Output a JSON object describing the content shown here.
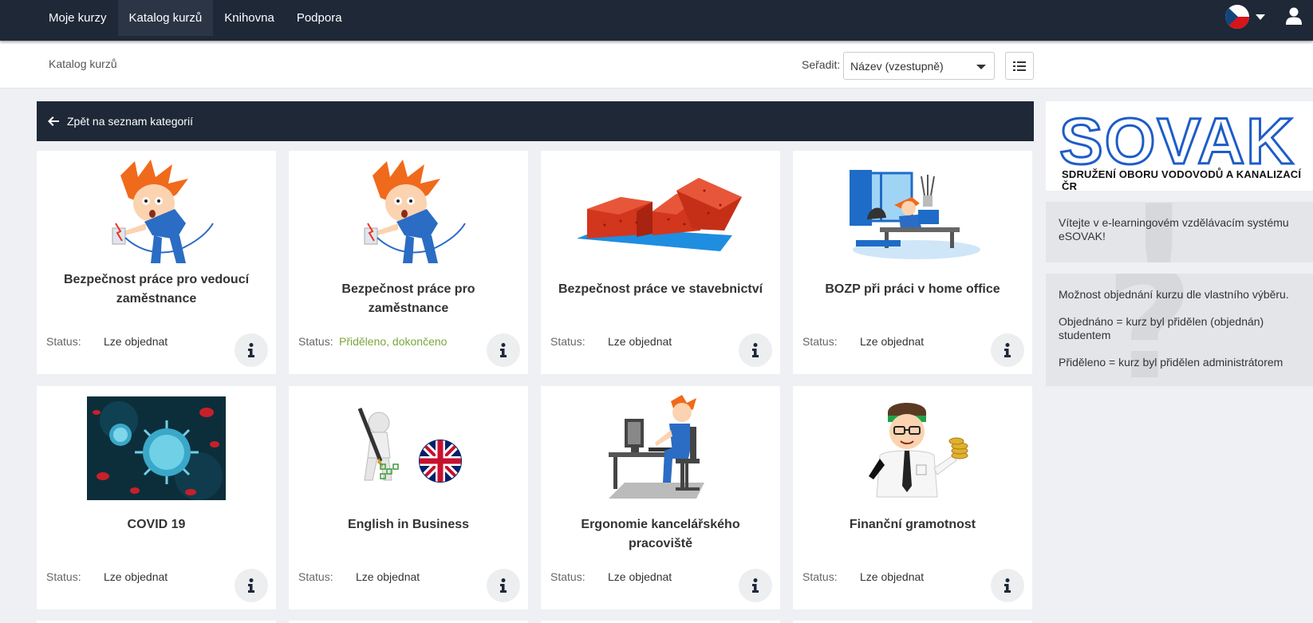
{
  "nav": {
    "items": [
      {
        "label": "Moje kurzy",
        "active": false
      },
      {
        "label": "Katalog kurzů",
        "active": true
      },
      {
        "label": "Knihovna",
        "active": false
      },
      {
        "label": "Podpora",
        "active": false
      }
    ]
  },
  "subheader": {
    "breadcrumb": "Katalog kurzů",
    "sort_label": "Seřadit:",
    "sort_value": "Název (vzestupně)"
  },
  "back_label": "Zpět na seznam kategorií",
  "status_label": "Status:",
  "courses": [
    {
      "title": "Bezpečnost práce pro vedoucí zaměstnance",
      "status": "Lze objednat",
      "status_color": "#333333"
    },
    {
      "title": "Bezpečnost práce pro zaměstnance",
      "status": "Přiděleno, dokončeno",
      "status_color": "#79a83b"
    },
    {
      "title": "Bezpečnost práce ve stavebnictví",
      "status": "Lze objednat",
      "status_color": "#333333"
    },
    {
      "title": "BOZP při práci v home office",
      "status": "Lze objednat",
      "status_color": "#333333"
    },
    {
      "title": "COVID 19",
      "status": "Lze objednat",
      "status_color": "#333333"
    },
    {
      "title": "English in Business",
      "status": "Lze objednat",
      "status_color": "#333333"
    },
    {
      "title": "Ergonomie kancelářského pracoviště",
      "status": "Lze objednat",
      "status_color": "#333333"
    },
    {
      "title": "Finanční gramotnost",
      "status": "Lze objednat",
      "status_color": "#333333"
    }
  ],
  "sidebar": {
    "logo_text": "SOVAK",
    "logo_subtitle": "SDRUŽENÍ OBORU VODOVODŮ A KANALIZACÍ ČR",
    "welcome": "Vítejte v e-learningovém vzdělávacím systému eSOVAK!",
    "info_lines": [
      "Možnost objednání kurzu dle vlastního výběru.",
      "Objednáno = kurz byl přidělen (objednán) studentem",
      "Přiděleno = kurz byl přidělen administrátorem"
    ]
  },
  "colors": {
    "nav_bg": "#1e2837",
    "accent_blue": "#1e5cc8",
    "status_green": "#79a83b"
  }
}
